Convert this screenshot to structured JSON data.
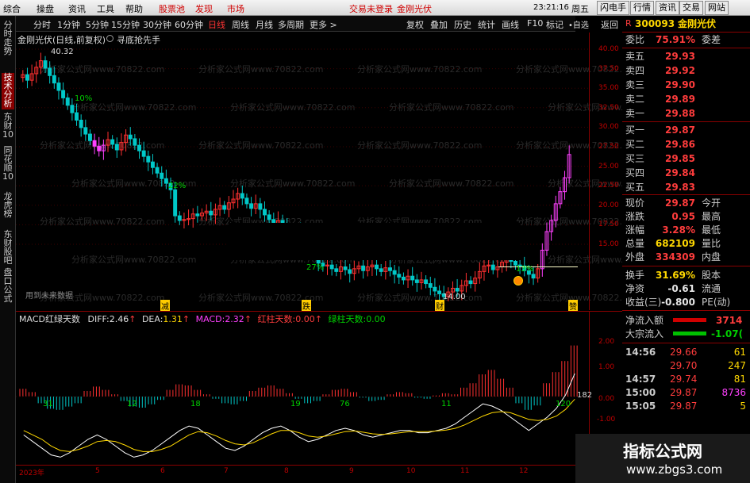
{
  "menubar": {
    "items": [
      "综合",
      "操盘",
      "资讯",
      "工具",
      "帮助"
    ],
    "highlight_items": [
      "股票池",
      "发现",
      "市场"
    ],
    "status": "交易未登录",
    "stock_name": "金刚光伏",
    "time": "23:21:16",
    "weekday": "周五",
    "right_buttons": [
      "闪电手",
      "行情",
      "资讯",
      "交易",
      "网站"
    ]
  },
  "sidebar": {
    "items": [
      "分时走势",
      "技术分析",
      "东财10",
      "同花顺10",
      "龙虎榜",
      "东财股吧",
      "盘口公式"
    ]
  },
  "period_bar": {
    "items": [
      "分时",
      "1分钟",
      "5分钟",
      "15分钟",
      "30分钟",
      "60分钟",
      "日线",
      "周线",
      "月线",
      "多周期",
      "更多 >"
    ],
    "active": "日线",
    "right_items": [
      "复权",
      "叠加",
      "历史",
      "统计",
      "画线",
      "F10",
      "标记",
      "•自选",
      "返回"
    ]
  },
  "main_chart": {
    "title": "金刚光伏(日线,前复权)",
    "subtitle": "寻底抢先手",
    "high_label": "40.32",
    "low_label": "14.00",
    "pct_labels": [
      "10%",
      "22%",
      "27%",
      "13%"
    ],
    "future_label": "用到未来数据",
    "markers": [
      "减",
      "跌",
      "财",
      "赞"
    ],
    "y_axis": [
      "40.00",
      "37.50",
      "35.00",
      "32.50",
      "30.00",
      "27.50",
      "25.00",
      "22.50",
      "20.00",
      "17.50",
      "15.00"
    ],
    "watermark": "分析家公式网www.70822.com"
  },
  "macd": {
    "name": "MACD红绿天数",
    "diff_label": "DIFF:",
    "diff_value": "2.46",
    "dea_label": "DEA:",
    "dea_value": "1.31",
    "macd_label": "MACD:",
    "macd_value": "2.32",
    "red_label": "红柱天数:",
    "red_value": "0.00",
    "green_label": "绿柱天数:",
    "green_value": "0.00",
    "bar_counts_red": [
      "31",
      "12",
      "18",
      "19",
      "11"
    ],
    "bar_counts_green": [
      "76",
      "120"
    ],
    "last_count": "182",
    "y_axis": [
      "2.00",
      "1.00",
      "0.00",
      "-1.00",
      "-2.00"
    ]
  },
  "x_axis": [
    "2023年",
    "5",
    "6",
    "7",
    "8",
    "9",
    "10",
    "11",
    "12"
  ],
  "quote": {
    "code": "300093",
    "name": "金刚光伏",
    "webi_label": "委比",
    "webi_value": "75.91%",
    "weicha_label": "委差",
    "asks": [
      {
        "label": "卖五",
        "price": "29.93"
      },
      {
        "label": "卖四",
        "price": "29.92"
      },
      {
        "label": "卖三",
        "price": "29.90"
      },
      {
        "label": "卖二",
        "price": "29.89"
      },
      {
        "label": "卖一",
        "price": "29.88"
      }
    ],
    "bids": [
      {
        "label": "买一",
        "price": "29.87"
      },
      {
        "label": "买二",
        "price": "29.86"
      },
      {
        "label": "买三",
        "price": "29.85"
      },
      {
        "label": "买四",
        "price": "29.84"
      },
      {
        "label": "买五",
        "price": "29.83"
      }
    ],
    "stats": [
      {
        "label": "现价",
        "value": "29.87",
        "right": "今开"
      },
      {
        "label": "涨跌",
        "value": "0.95",
        "right": "最高"
      },
      {
        "label": "涨幅",
        "value": "3.28%",
        "right": "最低"
      },
      {
        "label": "总量",
        "value": "682109",
        "right": "量比"
      },
      {
        "label": "外盘",
        "value": "334309",
        "right": "内盘"
      }
    ],
    "stats2": [
      {
        "label": "换手",
        "value": "31.69%",
        "right": "股本"
      },
      {
        "label": "净资",
        "value": "-0.61",
        "right": "流通"
      },
      {
        "label": "收益(三)",
        "value": "-0.800",
        "right": "PE(动)"
      }
    ],
    "flow": [
      {
        "label": "净流入额",
        "value": "3714"
      },
      {
        "label": "大宗流入",
        "value": "-1.07("
      }
    ],
    "ticks": [
      {
        "time": "14:56",
        "price": "29.66",
        "vol": "61"
      },
      {
        "time": "",
        "price": "29.70",
        "vol": "247"
      },
      {
        "time": "14:57",
        "price": "29.74",
        "vol": "81"
      },
      {
        "time": "15:00",
        "price": "29.87",
        "vol": "8736"
      },
      {
        "time": "15:05",
        "price": "29.87",
        "vol": "5"
      }
    ]
  },
  "logo": {
    "title": "指标公式网",
    "url": "www.zbgs3.com"
  },
  "kline": {
    "closes": [
      38.5,
      37.9,
      38.6,
      39.3,
      40.0,
      39.2,
      38.4,
      37.6,
      36.8,
      36.0,
      35.2,
      34.4,
      33.6,
      32.8,
      32.1,
      31.4,
      30.8,
      30.3,
      30.9,
      31.5,
      31.0,
      30.4,
      31.2,
      32.0,
      31.6,
      30.9,
      30.3,
      29.7,
      29.1,
      28.5,
      27.9,
      27.3,
      26.8,
      26.1,
      23.3,
      22.8,
      22.9,
      23.0,
      23.5,
      23.3,
      23.6,
      23.8,
      23.4,
      24.0,
      24.4,
      24.0,
      24.7,
      25.1,
      25.7,
      25.2,
      24.6,
      24.1,
      24.6,
      24.0,
      23.4,
      22.9,
      22.4,
      22.8,
      22.2,
      21.7,
      21.2,
      21.6,
      21.1,
      20.7,
      20.3,
      19.9,
      18.2,
      17.9,
      18.0,
      17.6,
      17.3,
      17.8,
      17.5,
      17.1,
      17.6,
      17.9,
      17.4,
      17.8,
      18.0,
      17.6,
      17.3,
      17.7,
      17.4,
      17.0,
      16.7,
      16.4,
      16.8,
      16.4,
      16.1,
      16.4,
      16.0,
      15.6,
      15.2,
      14.9,
      14.6,
      15.1,
      15.5,
      15.2,
      15.8,
      16.3,
      16.0,
      16.6,
      17.3,
      17.9,
      18.0,
      17.5,
      17.8,
      18.3,
      18.8,
      18.4,
      18.0,
      17.9,
      17.4,
      17.0,
      16.6,
      17.6,
      19.6,
      21.6,
      22.8,
      24.6,
      25.9,
      27.4,
      29.9
    ]
  },
  "macd_series": {
    "hist": [
      0.35,
      0.2,
      -0.3,
      -0.55,
      -0.6,
      -0.45,
      -0.3,
      0.25,
      0.45,
      0.3,
      0.1,
      -0.2,
      -0.45,
      -0.5,
      -0.35,
      -0.15,
      0.3,
      0.55,
      0.5,
      0.3,
      0.1,
      -0.1,
      -0.3,
      -0.35,
      -0.2,
      0.25,
      0.4,
      0.5,
      0.35,
      0.15,
      -0.1,
      -0.3,
      -0.2,
      0.1,
      0.3,
      0.35,
      0.2,
      -0.05,
      -0.2,
      -0.15,
      0.1,
      0.2,
      0.15,
      -0.05,
      -0.1,
      0.05,
      0.15,
      0.1,
      0.4,
      0.6,
      1.0,
      1.2,
      0.8,
      0.4,
      -0.3,
      -0.6,
      -0.4,
      0.6,
      1.1,
      1.6,
      2.3
    ],
    "dif": [
      -0.3,
      -0.6,
      -0.9,
      -1.2,
      -1.3,
      -1.1,
      -0.8,
      -0.5,
      -0.3,
      -0.5,
      -0.8,
      -1.1,
      -1.3,
      -1.2,
      -1.0,
      -0.7,
      -0.4,
      -0.1,
      0.1,
      0.0,
      -0.3,
      -0.6,
      -0.9,
      -1.0,
      -0.8,
      -0.5,
      -0.2,
      0.0,
      0.1,
      -0.1,
      -0.4,
      -0.6,
      -0.5,
      -0.3,
      -0.1,
      0.0,
      -0.1,
      -0.3,
      -0.4,
      -0.3,
      -0.2,
      -0.1,
      -0.1,
      -0.2,
      -0.2,
      -0.1,
      0.0,
      0.2,
      0.5,
      0.8,
      1.1,
      1.0,
      0.8,
      0.5,
      0.2,
      -0.1,
      0.2,
      0.5,
      0.9,
      1.5,
      2.46
    ],
    "dea": [
      -0.1,
      -0.3,
      -0.5,
      -0.8,
      -1.0,
      -1.05,
      -0.95,
      -0.8,
      -0.6,
      -0.55,
      -0.6,
      -0.75,
      -0.95,
      -1.05,
      -1.05,
      -0.95,
      -0.8,
      -0.55,
      -0.3,
      -0.15,
      -0.2,
      -0.35,
      -0.55,
      -0.7,
      -0.75,
      -0.65,
      -0.45,
      -0.25,
      -0.1,
      -0.1,
      -0.2,
      -0.35,
      -0.4,
      -0.35,
      -0.25,
      -0.15,
      -0.12,
      -0.18,
      -0.25,
      -0.28,
      -0.25,
      -0.2,
      -0.15,
      -0.15,
      -0.15,
      -0.12,
      -0.08,
      0.0,
      0.15,
      0.35,
      0.55,
      0.7,
      0.75,
      0.7,
      0.55,
      0.4,
      0.35,
      0.4,
      0.55,
      0.85,
      1.31
    ]
  }
}
